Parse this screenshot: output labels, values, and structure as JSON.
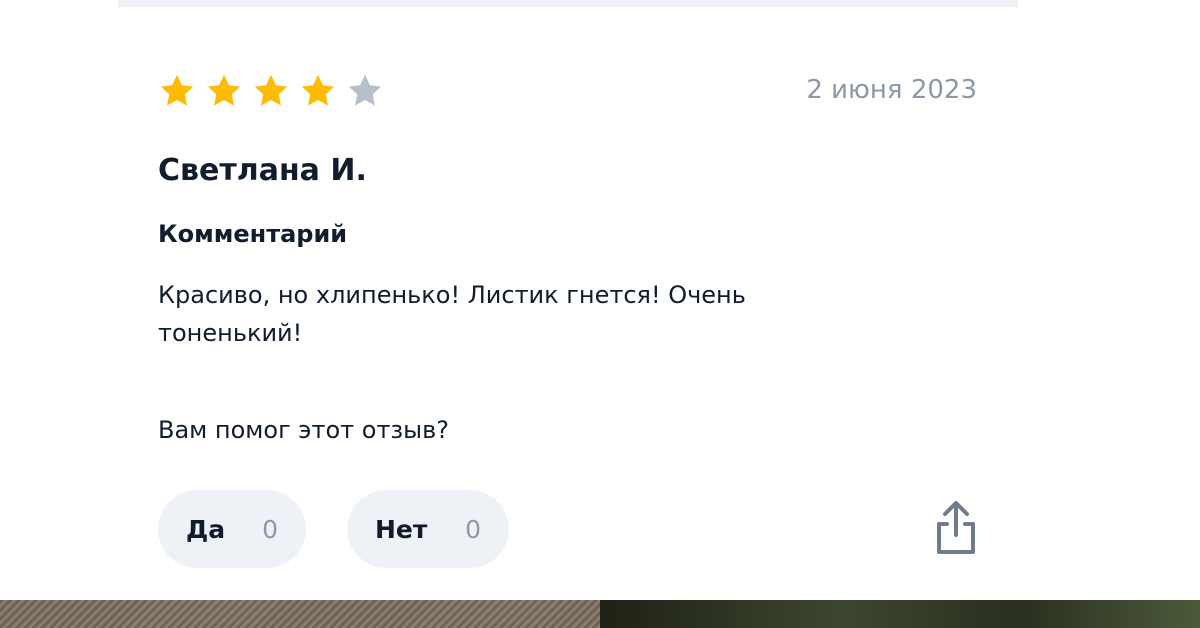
{
  "review": {
    "rating": 4,
    "rating_max": 5,
    "date": "2 июня 2023",
    "author": "Светлана И.",
    "comment_heading": "Комментарий",
    "comment_text": "Красиво, но хлипенько! Листик гнется! Очень тоненький!",
    "helpful_question": "Вам помог этот отзыв?",
    "votes": {
      "yes_label": "Да",
      "yes_count": "0",
      "no_label": "Нет",
      "no_count": "0"
    },
    "share_icon": "share-icon"
  },
  "colors": {
    "star_filled": "#ffbb00",
    "star_empty": "#b6bfca",
    "text": "#111c2d",
    "muted": "#8d98a7",
    "button_bg": "#eef2f7"
  }
}
